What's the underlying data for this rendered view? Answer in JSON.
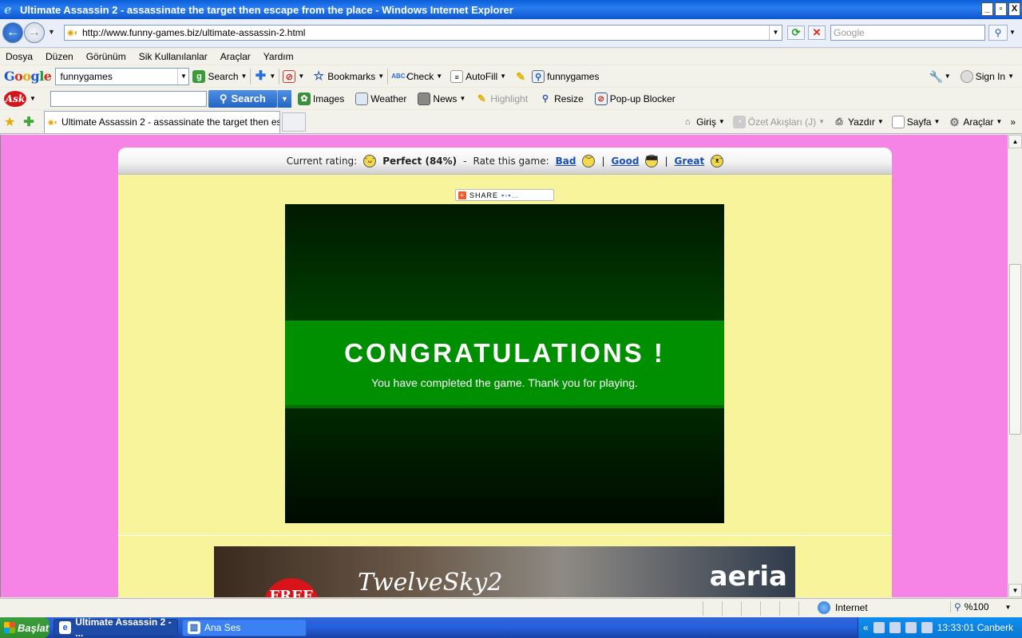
{
  "window": {
    "title": "Ultimate Assassin 2 - assassinate the target then escape from the place - Windows Internet Explorer",
    "controls": [
      "_",
      "▫",
      "X"
    ]
  },
  "address": {
    "url": "http://www.funny-games.biz/ultimate-assassin-2.html",
    "search_placeholder": "Google"
  },
  "menu": [
    "Dosya",
    "Düzen",
    "Görünüm",
    "Sik Kullanılanlar",
    "Araçlar",
    "Yardım"
  ],
  "google_toolbar": {
    "query": "funnygames",
    "search_label": "Search",
    "bookmarks_label": "Bookmarks",
    "check_label": "Check",
    "autofill_label": "AutoFill",
    "term_label": "funnygames",
    "signin_label": "Sign In"
  },
  "ask_toolbar": {
    "search_label": "Search",
    "items": [
      "Images",
      "Weather",
      "News",
      "Highlight",
      "Resize",
      "Pop-up Blocker"
    ]
  },
  "tabs": {
    "active_title": "Ultimate Assassin 2 - assassinate the target then esc..."
  },
  "command_bar": {
    "home": "Giriş",
    "feeds": "Özet Akışları (J)",
    "print": "Yazdır",
    "page": "Sayfa",
    "tools": "Araçlar"
  },
  "rating": {
    "current_label": "Current rating:",
    "current_value": "Perfect (84%)",
    "dash": "-",
    "rate_label": "Rate this game:",
    "bad": "Bad",
    "good": "Good",
    "great": "Great",
    "pipe": "|"
  },
  "share_label": "SHARE",
  "game": {
    "title": "CONGRATULATIONS !",
    "message": "You have completed the game. Thank you for playing."
  },
  "banner": {
    "free": "FREE",
    "brand": "TwelveSky2",
    "publisher": "aeria"
  },
  "status": {
    "zone": "Internet",
    "zoom": "%100"
  },
  "taskbar": {
    "start": "Başlat",
    "tasks": [
      "Ultimate Assassin 2 - ...",
      "Ana Ses"
    ],
    "clock": "13:33:01 Canberk"
  }
}
